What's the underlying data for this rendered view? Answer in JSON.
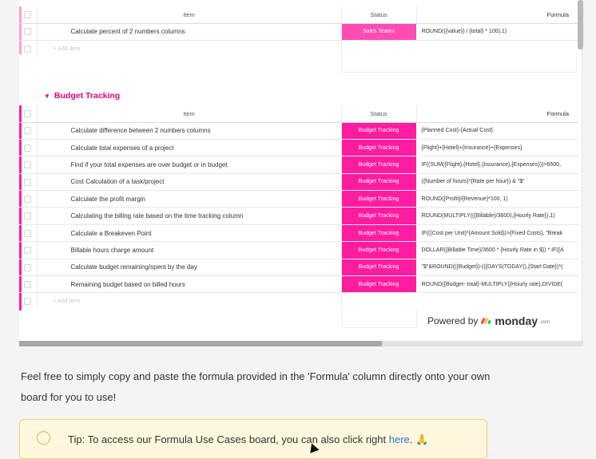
{
  "top_group": {
    "columns": {
      "item": "Item",
      "status": "Status",
      "formula": "Formula"
    },
    "rows": [
      {
        "item": "Calculate percent of 2 numbers columns",
        "status": "Sales Teams",
        "formula": "ROUND(({value}) / {total} * 100),1)"
      }
    ],
    "add_item": "+ Add Item"
  },
  "budget_group": {
    "title": "Budget Tracking",
    "columns": {
      "item": "Item",
      "status": "Status",
      "formula": "Formula"
    },
    "rows": [
      {
        "item": "Calculate difference between 2 numbers columns",
        "status": "Budget Tracking",
        "formula": "{Planned Cost}-{Actual Cost}"
      },
      {
        "item": "Calculate total expenses of a project",
        "status": "Budget Tracking",
        "formula": "{Flight}+{Hotel}+{Insurance}+{Expenses}"
      },
      {
        "item": "Find if your total expenses are over budget or in budget",
        "status": "Budget Tracking",
        "formula": "IF((SUM({Flight},{Hotel},{Insurance},{Expenses}))>6500,"
      },
      {
        "item": "Cost Calculation of a task/project",
        "status": "Budget Tracking",
        "formula": "({Number of hours}*{Rate per hour}) & \"$\""
      },
      {
        "item": "Calculate the profit margin",
        "status": "Budget Tracking",
        "formula": "ROUND({Profit}/{Revenue}*100, 1)"
      },
      {
        "item": "Calculating the billing rate based on the time tracking column",
        "status": "Budget Tracking",
        "formula": "ROUND(MULTIPLY(({Billable}/3600),{Hourly Rate}),1)"
      },
      {
        "item": "Calculate a Breakeven Point",
        "status": "Budget Tracking",
        "formula": "IF(({Cost per Unit}*{Amount Sold})>{Fixed Costs}, \"Break"
      },
      {
        "item": "Billable hours charge amount",
        "status": "Budget Tracking",
        "formula": "DOLLAR({Billable Time}/3600 * {Hourly Rate in $}) * IF({A"
      },
      {
        "item": "Calculate budget remaining/spent by the day",
        "status": "Budget Tracking",
        "formula": "\"$\"&ROUND(({Budget})-(({DAYS(TODAY(),{Start Date})*("
      },
      {
        "item": "Remaining budget based on billed hours",
        "status": "Budget Tracking",
        "formula": "ROUND({Budget- total}-MULTIPLY({Hourly rate},DIVIDE("
      }
    ],
    "add_item": "+ Add Item"
  },
  "powered_by": {
    "label": "Powered by",
    "brand": "monday",
    "brand_suffix": ".com"
  },
  "description": "Feel free to simply copy and paste the formula provided in the 'Formula' column directly onto your own board for you to use!",
  "tip": {
    "text": "Tip: To access our Formula Use Cases board, you can also click right ",
    "link": "here",
    "suffix": ". 🙏",
    "icon": "lightbulb-icon"
  },
  "colors": {
    "accent": "#e6007e",
    "status": "#ff1c9e",
    "tip_border": "#f2d16a",
    "link": "#2f73c8"
  }
}
